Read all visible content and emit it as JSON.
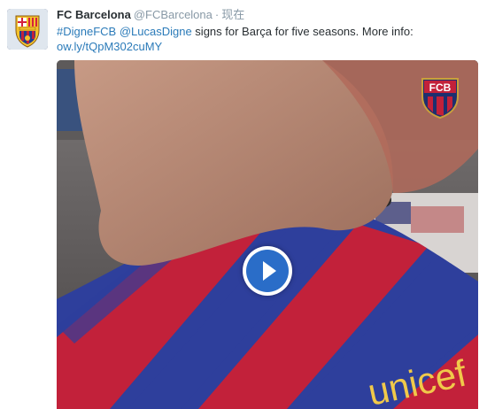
{
  "tweet": {
    "display_name": "FC Barcelona",
    "handle": "@FCBarcelona",
    "separator": "·",
    "time": "现在",
    "text_parts": {
      "hashtag": "#DigneFCB",
      "mention": "@LucasDigne",
      "body": " signs for Barça for five seasons. More info:",
      "link": "ow.ly/tQpM302cuMY"
    }
  },
  "media": {
    "type": "video",
    "overlay_logo": "FCB",
    "shirt_text": "unicef"
  },
  "colors": {
    "name": "#292f33",
    "meta": "#8899a6",
    "link": "#2b7bb9",
    "play_button": "#2a6dc8",
    "blaugrana_blue": "#2e3f9c",
    "blaugrana_red": "#c2213a"
  },
  "icons": {
    "avatar": "fc-barcelona-crest",
    "play": "play-icon"
  }
}
